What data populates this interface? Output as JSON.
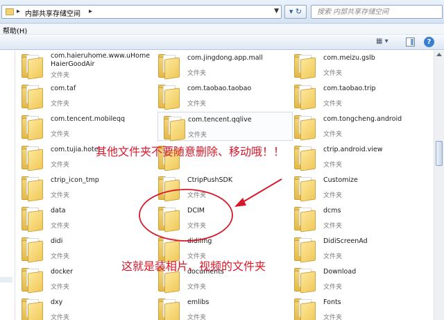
{
  "address_bar": {
    "path": "内部共享存储空间",
    "search_placeholder": "搜索 内部共享存储空间"
  },
  "menu": {
    "help": "帮助(H)"
  },
  "toolbar": {
    "view_label": "▦ ▾"
  },
  "items": [
    {
      "name": "com.haieruhome.www.uHomeHaierGoodAir",
      "type": "文件夹"
    },
    {
      "name": "com.jingdong.app.mall",
      "type": "文件夹"
    },
    {
      "name": "com.meizu.gslb",
      "type": "文件夹"
    },
    {
      "name": "com.taf",
      "type": "文件夹"
    },
    {
      "name": "com.taobao.taobao",
      "type": "文件夹"
    },
    {
      "name": "com.taobao.trip",
      "type": "文件夹"
    },
    {
      "name": "com.tencent.mobileqq",
      "type": "文件夹"
    },
    {
      "name": "com.tencent.qqlive",
      "type": "文件夹"
    },
    {
      "name": "com.tongcheng.android",
      "type": "文件夹"
    },
    {
      "name": "com.tujia.hotel",
      "type": "文件夹"
    },
    {
      "name": "",
      "type": ""
    },
    {
      "name": "ctrip.android.view",
      "type": "文件夹"
    },
    {
      "name": "ctrip_icon_tmp",
      "type": "文件夹"
    },
    {
      "name": "CtripPushSDK",
      "type": "文件夹"
    },
    {
      "name": "Customize",
      "type": "文件夹"
    },
    {
      "name": "data",
      "type": "文件夹"
    },
    {
      "name": "DCIM",
      "type": "文件夹"
    },
    {
      "name": "dcms",
      "type": "文件夹"
    },
    {
      "name": "didi",
      "type": "文件夹"
    },
    {
      "name": "didiImg",
      "type": "文件夹"
    },
    {
      "name": "DidiScreenAd",
      "type": "文件夹"
    },
    {
      "name": "docker",
      "type": "文件夹"
    },
    {
      "name": "documents",
      "type": "文件夹"
    },
    {
      "name": "Download",
      "type": "文件夹"
    },
    {
      "name": "dxy",
      "type": "文件夹"
    },
    {
      "name": "emlibs",
      "type": "文件夹"
    },
    {
      "name": "Fonts",
      "type": "文件夹"
    }
  ],
  "annotations": {
    "warning": "其他文件夹不要随意删除、移动哦！！",
    "dcim_note": "这就是装相片、视频的文件夹"
  },
  "colors": {
    "annotation_red": "#d8182a"
  }
}
